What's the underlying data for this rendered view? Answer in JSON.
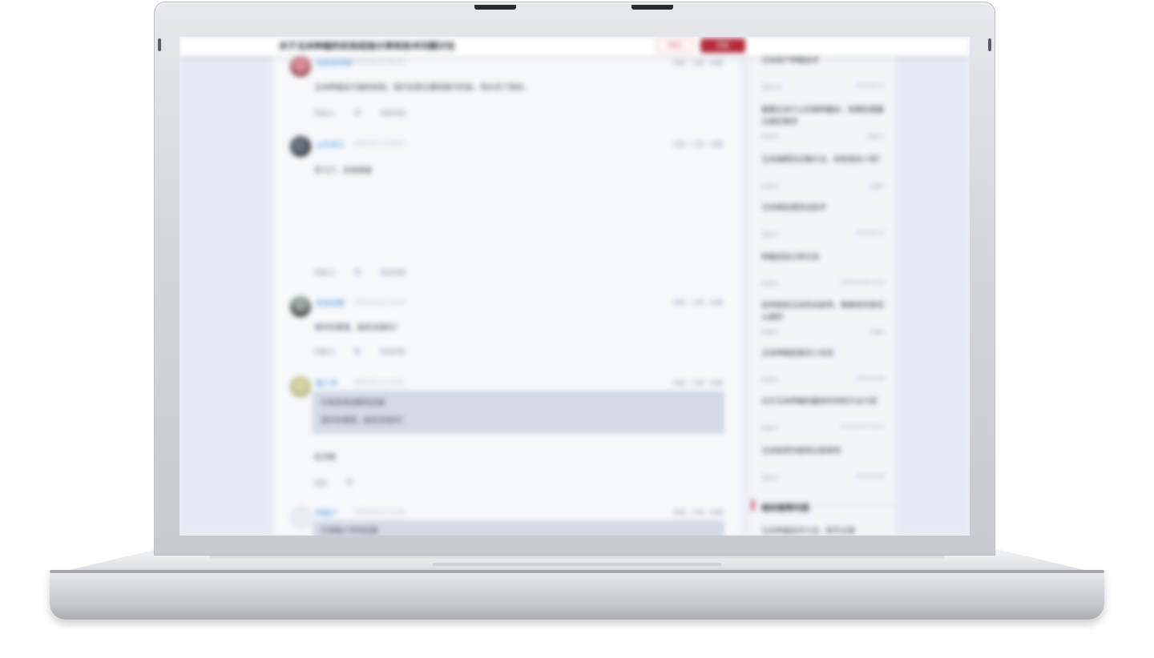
{
  "colors": {
    "accent": "#b32b3c",
    "link": "#3f8ee0",
    "page_background": "#eef1f6",
    "quote_background": "#d3d9e6"
  },
  "header": {
    "title": "关于玉米种植的实际经验分享和技术问题讨论",
    "follow_label": "关注",
    "reply_label": "回复"
  },
  "comments": [
    {
      "user": "农民张师傅",
      "time": "2019-03-12 08:25",
      "tools": "举报 · 引用 · 收藏",
      "text": "玉米种植这方面的经验，我们这里主要是靠天吃饭，雨水多了就好。",
      "actions": [
        "回复(1)",
        "赞",
        "收起回复"
      ]
    },
    {
      "user": "山东老王",
      "time": "2019-03-12 09:40",
      "tools": "举报 · 引用 · 收藏",
      "text": "学习了，非常感谢",
      "actions": [
        "回复(2)",
        "赞",
        "收起回复"
      ]
    },
    {
      "user": "青青田野",
      "time": "2019-03-12 10:03",
      "tools": "举报 · 引用 · 收藏",
      "text": "请问在哪里，能告诉我吗？",
      "actions": [
        "回复(3)",
        "赞",
        "收起回复"
      ]
    },
    {
      "user": "路人甲",
      "time": "2019-03-12 10:31",
      "tools": "举报 · 引用 · 收藏",
      "quote_user": "青青田野",
      "quote_line_1": "引用青青田野的回复",
      "quote_line_2": "请问在哪里，能告诉我吗？",
      "text": "在河南",
      "actions": [
        "回复",
        "赞"
      ]
    },
    {
      "user": "种植户",
      "time": "2019-03-12 11:02",
      "tools": "举报 · 引用 · 收藏",
      "quote_line_1": "引用路人甲的回复"
    }
  ],
  "sidebar": {
    "items": [
      {
        "title": "玉米高产种植技术",
        "meta_left": "阅读128",
        "meta_right": "2019-03-11"
      },
      {
        "title": "春播玉米什么时候种最好，有哪些需要注意的事项",
        "meta_left": "阅读96",
        "meta_right": "回复12"
      },
      {
        "title": "玉米施肥的正确方法，你知道多少呢？",
        "meta_left": "阅读85",
        "meta_right": "回复7"
      },
      {
        "title": "玉米病虫害防治技术",
        "meta_left": "阅读74",
        "meta_right": "2019-03-10"
      },
      {
        "title": "种植经验分享交流",
        "meta_left": "阅读63",
        "meta_right": "2019-03-09 15:20"
      },
      {
        "title": "如何提高玉米的出苗率，看看老农是怎么做的",
        "meta_left": "阅读51",
        "meta_right": "回复5"
      },
      {
        "title": "玉米种植密度多少合适",
        "meta_left": "阅读42",
        "meta_right": "2019-03-08"
      },
      {
        "title": "北方玉米种植的最佳时间和方法介绍",
        "meta_left": "阅读37",
        "meta_right": "2019-03-07 09:12"
      },
      {
        "title": "玉米除草剂使用注意事项",
        "meta_left": "阅读29",
        "meta_right": "2019-03-06"
      }
    ],
    "section_title": "相关推荐内容",
    "section_text": "玉米种植技术大全，新手必看"
  }
}
